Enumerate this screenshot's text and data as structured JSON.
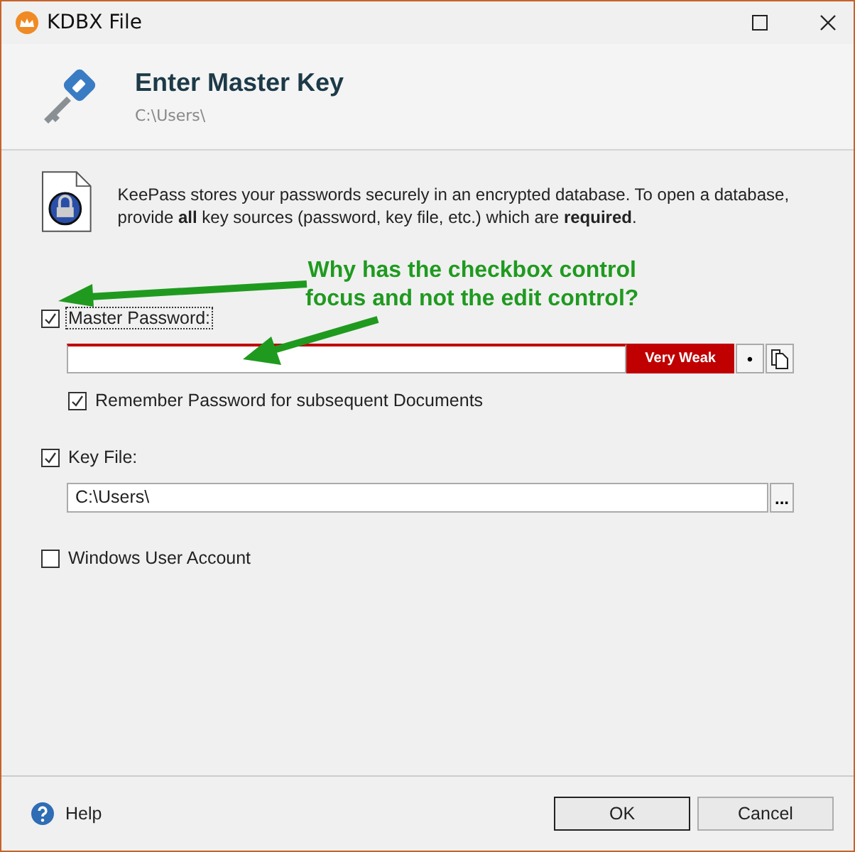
{
  "window": {
    "title": "KDBX File"
  },
  "header": {
    "title": "Enter Master Key",
    "path": "C:\\Users\\"
  },
  "info": "KeePass stores your passwords securely in an encrypted database. To open a database, provide **all** key sources (password, key file, etc.) which are **required**.",
  "master_password": {
    "label": "Master Password:",
    "checked": true,
    "focused": true,
    "strength": "Very Weak",
    "hide_button": "•"
  },
  "remember": {
    "label": "Remember Password for subsequent Documents",
    "checked": true
  },
  "key_file": {
    "label": "Key File:",
    "checked": true,
    "value": "C:\\Users\\",
    "browse_button": "..."
  },
  "windows_account": {
    "label": "Windows User Account",
    "checked": false
  },
  "footer": {
    "help": "Help",
    "buttons": [
      {
        "label": "OK",
        "default": true
      },
      {
        "label": "Cancel",
        "default": false
      }
    ]
  },
  "annotation": {
    "lines": [
      "Why has the checkbox control",
      "focus and not the edit control?"
    ]
  }
}
